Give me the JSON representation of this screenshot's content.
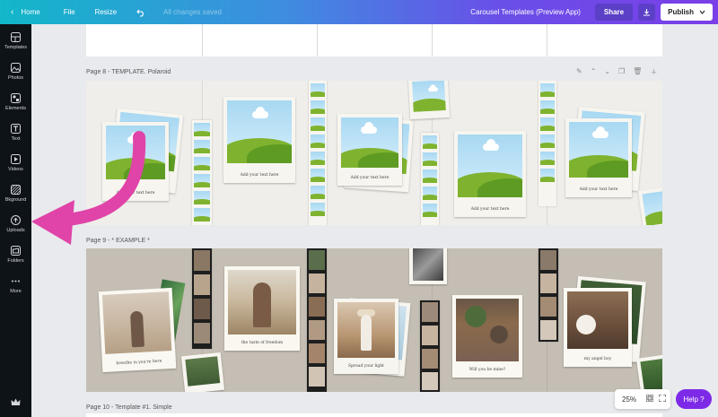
{
  "topbar": {
    "home_label": "Home",
    "file_label": "File",
    "resize_label": "Resize",
    "saved_label": "All changes saved",
    "doc_title": "Carousel Templates (Preview App)",
    "share_label": "Share",
    "publish_label": "Publish"
  },
  "sidebar": {
    "items": [
      {
        "label": "Templates",
        "icon": "templates-icon"
      },
      {
        "label": "Photos",
        "icon": "photos-icon"
      },
      {
        "label": "Elements",
        "icon": "elements-icon"
      },
      {
        "label": "Text",
        "icon": "text-icon"
      },
      {
        "label": "Videos",
        "icon": "videos-icon"
      },
      {
        "label": "Bkground",
        "icon": "background-icon"
      },
      {
        "label": "Uploads",
        "icon": "uploads-icon"
      },
      {
        "label": "Folders",
        "icon": "folders-icon"
      },
      {
        "label": "More",
        "icon": "more-icon"
      }
    ]
  },
  "pages": {
    "page8_label": "Page 8 - TEMPLATE. Polaroid",
    "page9_label": "Page 9 - * EXAMPLE *",
    "page10_label": "Page 10 - Template #1. Simple"
  },
  "page8": {
    "captions": [
      "Add your text here",
      "Add your text here",
      "Add your text here",
      "Add your text here",
      "Add your text here"
    ]
  },
  "page9": {
    "captions": [
      "breathe in you're here",
      "the taste of freedom",
      "Spread your light",
      "Will you be mine?",
      "my angel boy"
    ]
  },
  "zoom": {
    "value": "25%"
  },
  "help": {
    "label": "Help ?"
  },
  "colors": {
    "arrow": "#e044a8",
    "accent": "#7d2ae8"
  }
}
